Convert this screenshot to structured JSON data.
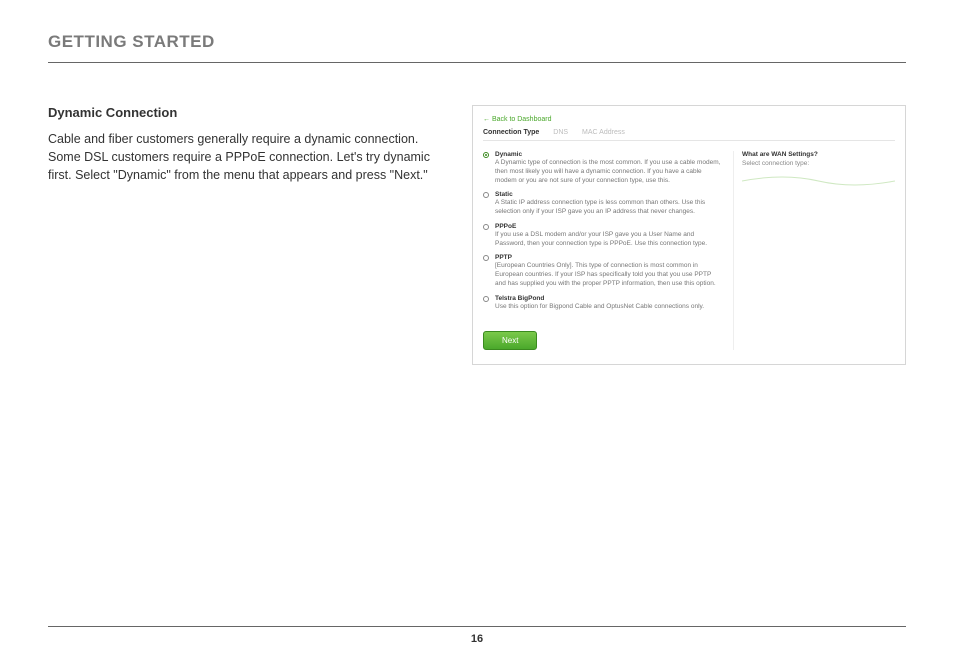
{
  "header": {
    "title": "GETTING STARTED"
  },
  "left": {
    "section_title": "Dynamic Connection",
    "body": "Cable and fiber customers generally require a dynamic connection. Some DSL customers require a PPPoE connection. Let's try dynamic first. Select \"Dynamic\" from the menu that appears and press \"Next.\""
  },
  "shot": {
    "back_link": "← Back to Dashboard",
    "tabs": [
      "Connection Type",
      "DNS",
      "MAC Address"
    ],
    "side": {
      "title": "What are WAN Settings?",
      "sub": "Select connection type:"
    },
    "options": [
      {
        "title": "Dynamic",
        "desc": "A Dynamic type of connection is the most common. If you use a cable modem, then most likely you will have a dynamic connection. If you have a cable modem or you are not sure of your connection type, use this.",
        "selected": true
      },
      {
        "title": "Static",
        "desc": "A Static IP address connection type is less common than others. Use this selection only if your ISP gave you an IP address that never changes.",
        "selected": false
      },
      {
        "title": "PPPoE",
        "desc": "If you use a DSL modem and/or your ISP gave you a User Name and Password, then your connection type is PPPoE. Use this connection type.",
        "selected": false
      },
      {
        "title": "PPTP",
        "desc": "[European Countries Only]. This type of connection is most common in European countries. If your ISP has specifically told you that you use PPTP and has supplied you with the proper PPTP information, then use this option.",
        "selected": false
      },
      {
        "title": "Telstra BigPond",
        "desc": "Use this option for Bigpond Cable and OptusNet Cable connections only.",
        "selected": false
      }
    ],
    "next_label": "Next"
  },
  "footer": {
    "page_number": "16"
  }
}
